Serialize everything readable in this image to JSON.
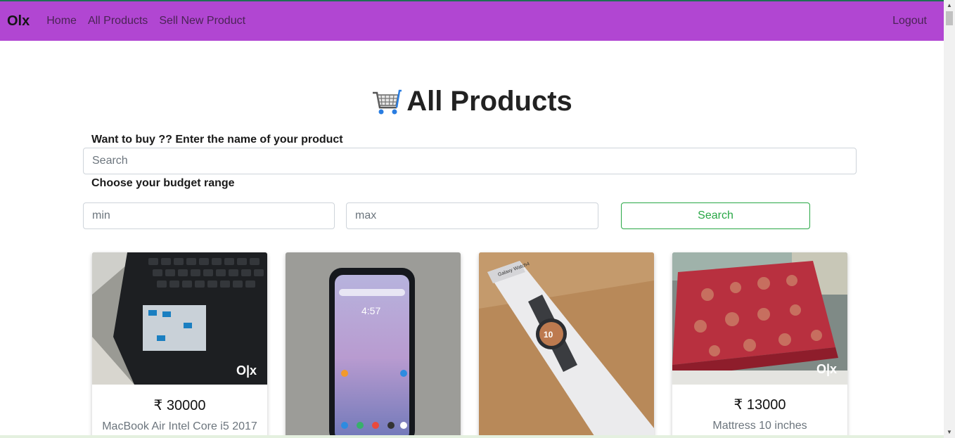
{
  "nav": {
    "brand": "Olx",
    "links": [
      "Home",
      "All Products",
      "Sell New Product"
    ],
    "logout": "Logout"
  },
  "page": {
    "title": "All Products",
    "search_label": "Want to buy ?? Enter the name of your product",
    "search_placeholder": "Search",
    "budget_label": "Choose your budget range",
    "min_placeholder": "min",
    "max_placeholder": "max",
    "search_button": "Search"
  },
  "products": [
    {
      "price": "₹ 30000",
      "name": "MacBook Air Intel Core i5 2017"
    },
    {
      "price": "",
      "name": ""
    },
    {
      "price": "",
      "name": ""
    },
    {
      "price": "₹ 13000",
      "name": "Mattress 10 inches"
    }
  ],
  "colors": {
    "navbar": "#b146d2",
    "accent": "#28a745"
  }
}
